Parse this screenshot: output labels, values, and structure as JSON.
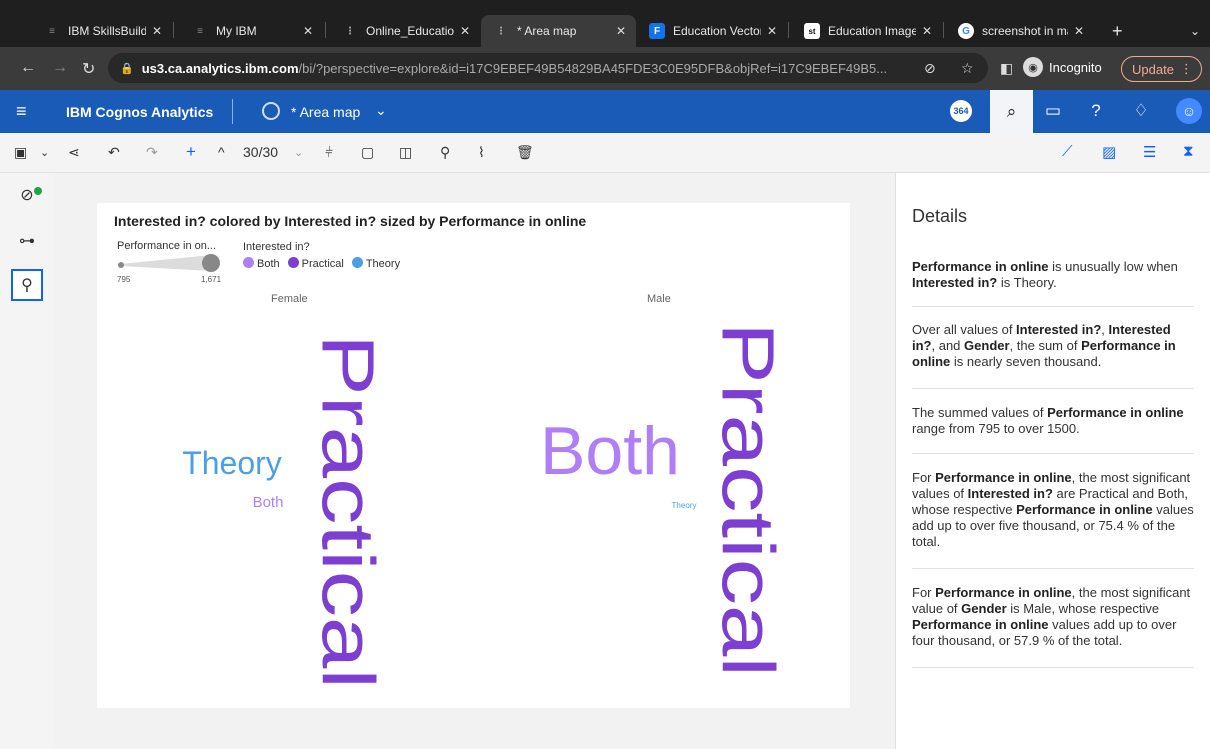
{
  "browser": {
    "tabs": [
      {
        "label": "IBM SkillsBuild So",
        "icon": "ibm-logo-icon"
      },
      {
        "label": "My IBM",
        "icon": "ibm-logo-icon"
      },
      {
        "label": "Online_Education",
        "icon": "cognos-icon"
      },
      {
        "label": "* Area map",
        "icon": "cognos-icon"
      },
      {
        "label": "Education Vector",
        "icon": "freepik-icon"
      },
      {
        "label": "Education Images",
        "icon": "shutterstock-icon"
      },
      {
        "label": "screenshot in ma",
        "icon": "google-icon"
      }
    ],
    "new_tab": "+",
    "url_host": "us3.ca.analytics.ibm.com",
    "url_path": "/bi/?perspective=explore&id=i17C9EBEF49B54829BA45FDE3C0E95DFB&objRef=i17C9EBEF49B5...",
    "profile_label": "Incognito",
    "update_label": "Update"
  },
  "appbar": {
    "brand": "IBM Cognos Analytics",
    "report_name": "* Area map",
    "notification_count": "364"
  },
  "toolbar": {
    "page_counter": "30/30"
  },
  "chart": {
    "title": "Interested in? colored by Interested in? sized by Performance in online",
    "size_legend_title": "Performance in on...",
    "size_min": "795",
    "size_max": "1,671",
    "color_legend_title": "Interested in?",
    "facets": [
      "Female",
      "Male"
    ]
  },
  "chart_data": {
    "type": "word-cloud",
    "title": "Interested in? colored by Interested in? sized by Performance in online",
    "size_range": [
      795,
      1671
    ],
    "legend": [
      {
        "name": "Both",
        "color": "#b07ef5"
      },
      {
        "name": "Practical",
        "color": "#7c3fd1"
      },
      {
        "name": "Theory",
        "color": "#4a9fe8"
      }
    ],
    "facets": [
      {
        "name": "Female",
        "words": [
          {
            "text": "Practical",
            "color": "#7c3fd1",
            "orientation": "vertical"
          },
          {
            "text": "Theory",
            "color": "#4a9fe8",
            "orientation": "horizontal"
          },
          {
            "text": "Both",
            "color": "#b07ef5",
            "orientation": "horizontal"
          }
        ]
      },
      {
        "name": "Male",
        "words": [
          {
            "text": "Practical",
            "color": "#7c3fd1",
            "orientation": "vertical"
          },
          {
            "text": "Both",
            "color": "#b07ef5",
            "orientation": "horizontal"
          },
          {
            "text": "Theory",
            "color": "#4a9fe8",
            "orientation": "horizontal"
          }
        ]
      }
    ]
  },
  "details": {
    "heading": "Details",
    "insights": [
      [
        {
          "t": "Performance in online",
          "b": true
        },
        {
          "t": " is unusually low when "
        },
        {
          "t": "Interested in?",
          "b": true
        },
        {
          "t": " is Theory."
        }
      ],
      [
        {
          "t": "Over all values of "
        },
        {
          "t": "Interested in?",
          "b": true
        },
        {
          "t": ", "
        },
        {
          "t": "Interested in?",
          "b": true
        },
        {
          "t": ", and "
        },
        {
          "t": "Gender",
          "b": true
        },
        {
          "t": ", the sum of "
        },
        {
          "t": "Performance in online",
          "b": true
        },
        {
          "t": " is nearly seven thousand."
        }
      ],
      [
        {
          "t": "The summed values of "
        },
        {
          "t": "Performance in online",
          "b": true
        },
        {
          "t": " range from 795 to over 1500."
        }
      ],
      [
        {
          "t": "For "
        },
        {
          "t": "Performance in online",
          "b": true
        },
        {
          "t": ", the most significant values of "
        },
        {
          "t": "Interested in?",
          "b": true
        },
        {
          "t": " are Practical and Both, whose respective "
        },
        {
          "t": "Performance in online",
          "b": true
        },
        {
          "t": " values add up to over five thousand, or 75.4 % of the total."
        }
      ],
      [
        {
          "t": "For "
        },
        {
          "t": "Performance in online",
          "b": true
        },
        {
          "t": ", the most significant value of "
        },
        {
          "t": "Gender",
          "b": true
        },
        {
          "t": " is Male, whose respective "
        },
        {
          "t": "Performance in online",
          "b": true
        },
        {
          "t": " values add up to over four thousand, or 57.9 % of the total."
        }
      ]
    ]
  }
}
